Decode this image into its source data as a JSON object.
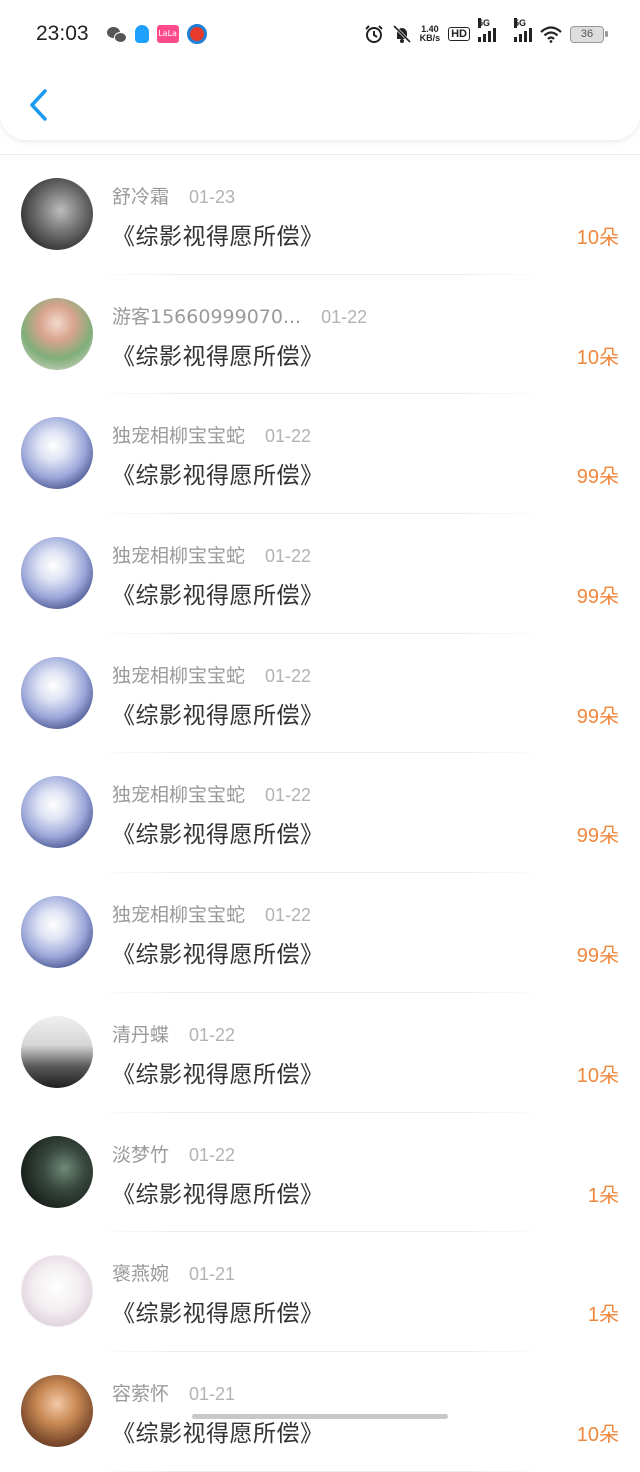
{
  "status_bar": {
    "time": "23:03",
    "net_speed_value": "1.40",
    "net_speed_unit": "KB/s",
    "hd_label": "HD",
    "sim1_label": "5G",
    "sim2_label": "5G",
    "battery": "36"
  },
  "lala_label": "LaLa",
  "records": [
    {
      "name": "舒冷霜",
      "date": "01-23",
      "title": "《综影视得愿所偿》",
      "amount": "10",
      "unit": "朵",
      "avatar": "lion"
    },
    {
      "name": "游客15660999070...",
      "date": "01-22",
      "title": "《综影视得愿所偿》",
      "amount": "10",
      "unit": "朵",
      "avatar": "woman1"
    },
    {
      "name": "独宠相柳宝宝蛇",
      "date": "01-22",
      "title": "《综影视得愿所偿》",
      "amount": "99",
      "unit": "朵",
      "avatar": "anime"
    },
    {
      "name": "独宠相柳宝宝蛇",
      "date": "01-22",
      "title": "《综影视得愿所偿》",
      "amount": "99",
      "unit": "朵",
      "avatar": "anime"
    },
    {
      "name": "独宠相柳宝宝蛇",
      "date": "01-22",
      "title": "《综影视得愿所偿》",
      "amount": "99",
      "unit": "朵",
      "avatar": "anime"
    },
    {
      "name": "独宠相柳宝宝蛇",
      "date": "01-22",
      "title": "《综影视得愿所偿》",
      "amount": "99",
      "unit": "朵",
      "avatar": "anime"
    },
    {
      "name": "独宠相柳宝宝蛇",
      "date": "01-22",
      "title": "《综影视得愿所偿》",
      "amount": "99",
      "unit": "朵",
      "avatar": "anime"
    },
    {
      "name": "清丹蝶",
      "date": "01-22",
      "title": "《综影视得愿所偿》",
      "amount": "10",
      "unit": "朵",
      "avatar": "bw"
    },
    {
      "name": "淡梦竹",
      "date": "01-22",
      "title": "《综影视得愿所偿》",
      "amount": "1",
      "unit": "朵",
      "avatar": "dark"
    },
    {
      "name": "褒燕婉",
      "date": "01-21",
      "title": "《综影视得愿所偿》",
      "amount": "1",
      "unit": "朵",
      "avatar": "girl"
    },
    {
      "name": "容萦怀",
      "date": "01-21",
      "title": "《综影视得愿所偿》",
      "amount": "10",
      "unit": "朵",
      "avatar": "blonde"
    }
  ],
  "colors": {
    "accent_blue": "#1a9bf0",
    "amount_orange": "#f0883e"
  }
}
